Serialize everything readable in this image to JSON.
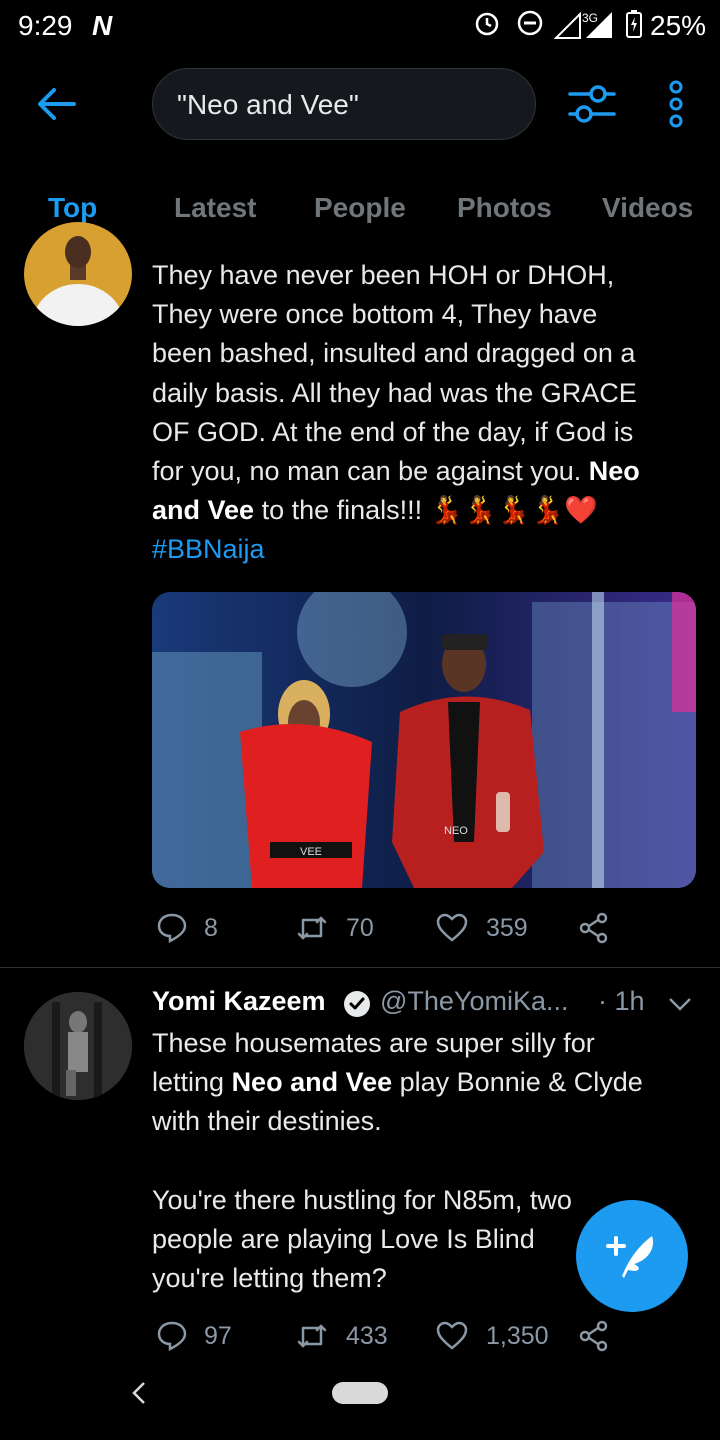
{
  "status_bar": {
    "time": "9:29",
    "network_type": "3G",
    "battery": "25%"
  },
  "search": {
    "query": "\"Neo and Vee\""
  },
  "tabs": [
    {
      "label": "Top",
      "active": true
    },
    {
      "label": "Latest",
      "active": false
    },
    {
      "label": "People",
      "active": false
    },
    {
      "label": "Photos",
      "active": false
    },
    {
      "label": "Videos",
      "active": false
    }
  ],
  "tweet1": {
    "text_lines": [
      "They have never been HOH or DHOH,",
      "They were once bottom 4, They have",
      "been bashed, insulted and dragged on a",
      "daily basis. All they had was the GRACE",
      "OF GOD. At the end of the day, if God is",
      "for you, no man can be against you."
    ],
    "highlight_1": "Neo",
    "highlight_2": "and Vee",
    "text_tail": " to the finals!!! ",
    "emojis": "💃💃💃💃❤️",
    "hashtag": "#BBNaija",
    "image_labels": {
      "belt_left": "VEE",
      "belt_right": "NEO"
    },
    "replies": "8",
    "retweets": "70",
    "likes": "359"
  },
  "tweet2": {
    "author_name": "Yomi Kazeem",
    "handle": "@TheYomiKa...",
    "time": "· 1h",
    "line1": "These housemates are super silly for",
    "line2_pre": "letting ",
    "line2_bold": "Neo and Vee",
    "line2_post": " play Bonnie & Clyde",
    "line3": "with their destinies.",
    "line4": "You're there hustling for N85m, two",
    "line5": "people are playing Love Is Blind",
    "line6": "you're letting them?",
    "replies": "97",
    "retweets": "433",
    "likes": "1,350"
  },
  "colors": {
    "accent": "#1d9bf0",
    "background": "#000000",
    "secondary_text": "#8b98a5"
  },
  "icons": [
    "back-arrow-icon",
    "filter-icon",
    "more-vertical-icon",
    "reply-icon",
    "retweet-icon",
    "like-icon",
    "share-icon",
    "verified-icon",
    "compose-icon"
  ]
}
